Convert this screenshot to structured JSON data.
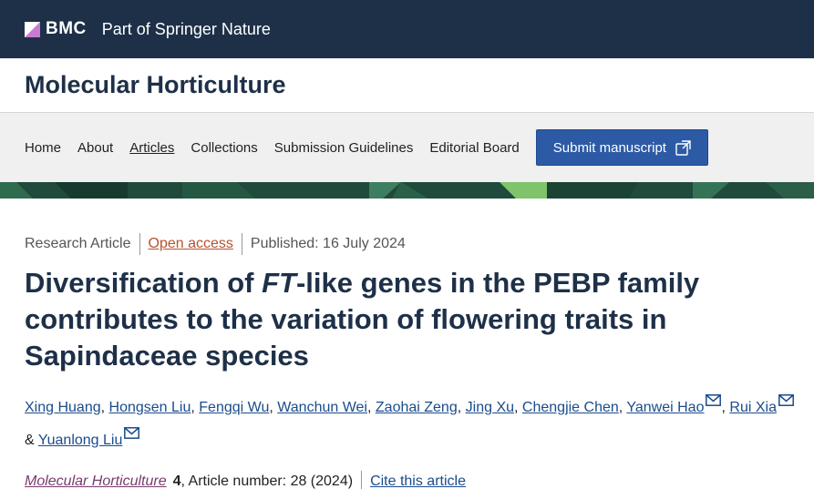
{
  "header": {
    "brand_name": "BMC",
    "brand_tagline": "Part of Springer Nature",
    "brand_color": "#1e3048"
  },
  "journal": {
    "title": "Molecular Horticulture"
  },
  "nav": {
    "items": [
      "Home",
      "About",
      "Articles",
      "Collections",
      "Submission Guidelines",
      "Editorial Board"
    ],
    "active": "Articles",
    "submit_label": "Submit manuscript",
    "submit_color": "#2d5aa5"
  },
  "article": {
    "type": "Research Article",
    "access": "Open access",
    "published": "Published: 16 July 2024",
    "title_pre": "Diversification of ",
    "title_em": "FT",
    "title_post": "-like genes in the PEBP family contributes to the variation of flowering traits in Sapindaceae species",
    "authors": [
      {
        "name": "Xing Huang",
        "mail": false,
        "suffix": ","
      },
      {
        "name": "Hongsen Liu",
        "mail": false,
        "suffix": ","
      },
      {
        "name": "Fengqi Wu",
        "mail": false,
        "suffix": ","
      },
      {
        "name": "Wanchun Wei",
        "mail": false,
        "suffix": ","
      },
      {
        "name": "Zaohai Zeng",
        "mail": false,
        "suffix": ","
      },
      {
        "name": "Jing Xu",
        "mail": false,
        "suffix": ","
      },
      {
        "name": "Chengjie Chen",
        "mail": false,
        "suffix": ","
      },
      {
        "name": "Yanwei Hao",
        "mail": true,
        "suffix": ","
      },
      {
        "name": "Rui Xia",
        "mail": true,
        "suffix": " &"
      },
      {
        "name": "Yuanlong Liu",
        "mail": true,
        "suffix": ""
      }
    ],
    "citation": {
      "journal": "Molecular Horticulture",
      "volume": "4",
      "details": ", Article number: 28 (2024)",
      "cite_label": "Cite this article"
    }
  }
}
